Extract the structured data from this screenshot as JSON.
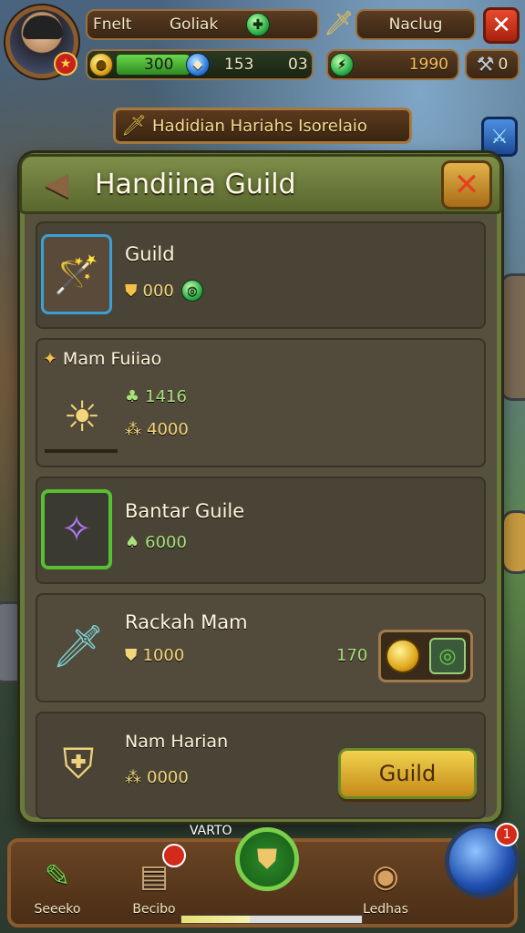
{
  "topbar": {
    "player_name": "Fnelt",
    "guild_name": "Goliak",
    "region_label": "Naclug",
    "gold": "300",
    "gems": "153",
    "gems_extra": "03",
    "energy": "1990",
    "icons": {
      "rank": "shield-icon",
      "guild": "green-gem-icon",
      "region": "sword-icon",
      "close": "close-icon",
      "tools": "hammer-icon"
    }
  },
  "banner": {
    "text": "Hadidian Hariahs Isorelaio"
  },
  "panel": {
    "title": "Handiina  Guild",
    "items": [
      {
        "name": "Guild",
        "stat1": "000",
        "icon": "staff-icon"
      },
      {
        "name": "Mam Fuiiao",
        "stat1": "1416",
        "stat2": "4000",
        "icon": "sun-emblem-icon"
      },
      {
        "name": "Bantar Guile",
        "stat1": "6000",
        "icon": "wand-icon"
      },
      {
        "name": "Rackah Mam",
        "stat1": "1000",
        "reward": "170",
        "icon": "dagger-icon"
      },
      {
        "name": "Nam Harian",
        "stat1": "0000",
        "icon": "winged-shield-icon",
        "button": "Guild"
      }
    ]
  },
  "bottombar": {
    "center_label": "VARTO",
    "items": [
      "Seeeko",
      "Becibo",
      "Ledhas"
    ],
    "badge_count_left": "",
    "badge_count_right": "1",
    "progress": 0.38
  },
  "colors": {
    "panel": "#56503e",
    "panel_border": "#6a7a3a",
    "accent_gold": "#f2d24e",
    "close_red": "#e84b2e"
  }
}
